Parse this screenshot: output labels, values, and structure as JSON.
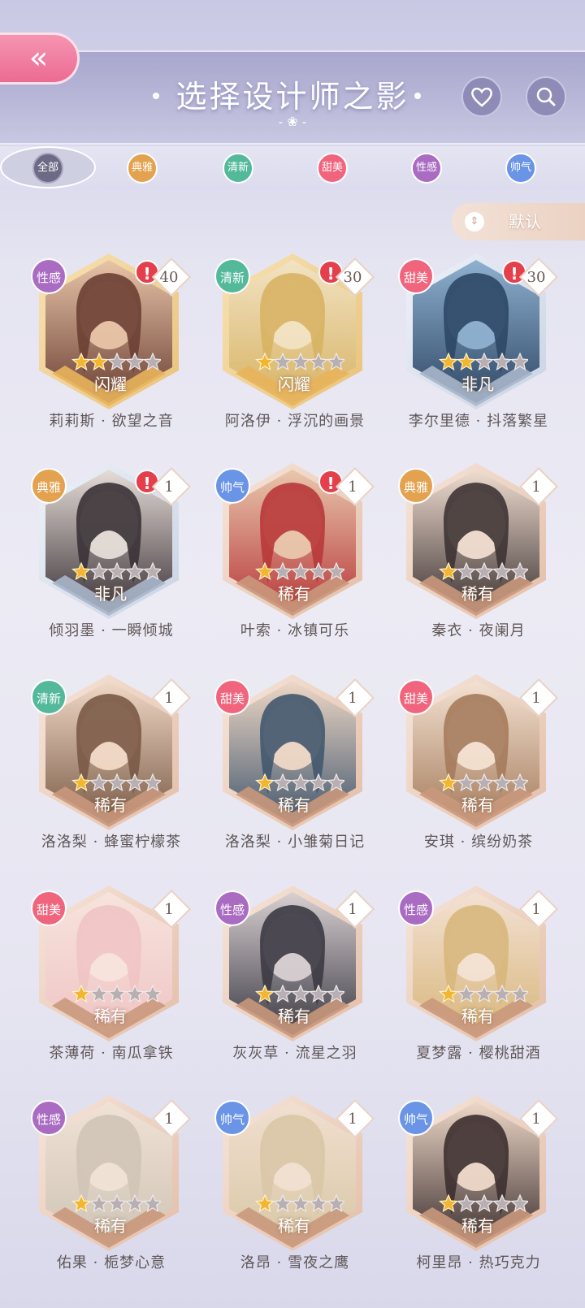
{
  "header": {
    "title": "选择设计师之影",
    "back_icon": "double-chevron-left",
    "favorite_icon": "heart",
    "search_icon": "magnifier"
  },
  "tabs": [
    {
      "label": "全部",
      "color": "#6d6a86",
      "selected": true
    },
    {
      "label": "典雅",
      "color": "#e3a24f",
      "selected": false
    },
    {
      "label": "清新",
      "color": "#53b99a",
      "selected": false
    },
    {
      "label": "甜美",
      "color": "#f0657d",
      "selected": false
    },
    {
      "label": "性感",
      "color": "#a96cc2",
      "selected": false
    },
    {
      "label": "帅气",
      "color": "#6a94e5",
      "selected": false
    }
  ],
  "sort": {
    "label": "默认",
    "icon": "sort-updown"
  },
  "cards": [
    {
      "style": "性感",
      "style_color": "#a96cc2",
      "alert": true,
      "count": "40",
      "rarity": "闪耀",
      "rarity_tone": "gold",
      "stars_filled": 2,
      "stars_total": 5,
      "name": "莉莉斯 · 欲望之音",
      "palette": [
        "#6b4034",
        "#e8c4a8"
      ]
    },
    {
      "style": "清新",
      "style_color": "#53b99a",
      "alert": true,
      "count": "30",
      "rarity": "闪耀",
      "rarity_tone": "gold",
      "stars_filled": 1,
      "stars_total": 5,
      "name": "阿洛伊 · 浮沉的画景",
      "palette": [
        "#d7b363",
        "#f2e3c4"
      ]
    },
    {
      "style": "甜美",
      "style_color": "#f0657d",
      "alert": true,
      "count": "30",
      "rarity": "非凡",
      "rarity_tone": "silver",
      "stars_filled": 2,
      "stars_total": 5,
      "name": "李尔里德 · 抖落繁星",
      "palette": [
        "#2e4866",
        "#8fb0cf"
      ]
    },
    {
      "style": "典雅",
      "style_color": "#e3a24f",
      "alert": true,
      "count": "1",
      "rarity": "非凡",
      "rarity_tone": "silver",
      "stars_filled": 1,
      "stars_total": 5,
      "name": "倾羽墨 · 一瞬倾城",
      "palette": [
        "#3a3236",
        "#e6ddd8"
      ]
    },
    {
      "style": "帅气",
      "style_color": "#6a94e5",
      "alert": true,
      "count": "1",
      "rarity": "稀有",
      "rarity_tone": "bronze",
      "stars_filled": 1,
      "stars_total": 5,
      "name": "叶索 · 冰镇可乐",
      "palette": [
        "#b8393a",
        "#e8c7ad"
      ]
    },
    {
      "style": "典雅",
      "style_color": "#e3a24f",
      "alert": false,
      "count": "1",
      "rarity": "稀有",
      "rarity_tone": "bronze",
      "stars_filled": 1,
      "stars_total": 5,
      "name": "秦衣 · 夜阑月",
      "palette": [
        "#3e3434",
        "#f0ddd0"
      ]
    },
    {
      "style": "清新",
      "style_color": "#53b99a",
      "alert": false,
      "count": "1",
      "rarity": "稀有",
      "rarity_tone": "bronze",
      "stars_filled": 1,
      "stars_total": 5,
      "name": "洛洛梨 · 蜂蜜柠檬茶",
      "palette": [
        "#7a5a46",
        "#f1dac7"
      ]
    },
    {
      "style": "甜美",
      "style_color": "#f0657d",
      "alert": false,
      "count": "1",
      "rarity": "稀有",
      "rarity_tone": "bronze",
      "stars_filled": 1,
      "stars_total": 5,
      "name": "洛洛梨 · 小雏菊日记",
      "palette": [
        "#43586e",
        "#efd8c6"
      ]
    },
    {
      "style": "甜美",
      "style_color": "#f0657d",
      "alert": false,
      "count": "1",
      "rarity": "稀有",
      "rarity_tone": "bronze",
      "stars_filled": 1,
      "stars_total": 5,
      "name": "安琪 · 缤纷奶茶",
      "palette": [
        "#a57b5c",
        "#f3e2d2"
      ]
    },
    {
      "style": "甜美",
      "style_color": "#f0657d",
      "alert": false,
      "count": "1",
      "rarity": "稀有",
      "rarity_tone": "bronze",
      "stars_filled": 1,
      "stars_total": 5,
      "name": "茶薄荷 · 南瓜拿铁",
      "palette": [
        "#efc4c4",
        "#f7e4dc"
      ]
    },
    {
      "style": "性感",
      "style_color": "#a96cc2",
      "alert": false,
      "count": "1",
      "rarity": "稀有",
      "rarity_tone": "bronze",
      "stars_filled": 1,
      "stars_total": 5,
      "name": "灰灰草 · 流星之羽",
      "palette": [
        "#3c3a44",
        "#d8d0d2"
      ]
    },
    {
      "style": "性感",
      "style_color": "#a96cc2",
      "alert": false,
      "count": "1",
      "rarity": "稀有",
      "rarity_tone": "bronze",
      "stars_filled": 1,
      "stars_total": 5,
      "name": "夏梦露 · 樱桃甜酒",
      "palette": [
        "#d8b77c",
        "#f3e1d4"
      ]
    },
    {
      "style": "性感",
      "style_color": "#a96cc2",
      "alert": false,
      "count": "1",
      "rarity": "稀有",
      "rarity_tone": "bronze",
      "stars_filled": 1,
      "stars_total": 5,
      "name": "佑果 · 栀梦心意",
      "palette": [
        "#cfc4b6",
        "#f0e2d6"
      ]
    },
    {
      "style": "帅气",
      "style_color": "#6a94e5",
      "alert": false,
      "count": "1",
      "rarity": "稀有",
      "rarity_tone": "bronze",
      "stars_filled": 1,
      "stars_total": 5,
      "name": "洛昂 · 雪夜之鹰",
      "palette": [
        "#d9c7a6",
        "#f1dfd0"
      ]
    },
    {
      "style": "帅气",
      "style_color": "#6a94e5",
      "alert": false,
      "count": "1",
      "rarity": "稀有",
      "rarity_tone": "bronze",
      "stars_filled": 1,
      "stars_total": 5,
      "name": "柯里昂 · 热巧克力",
      "palette": [
        "#3d3030",
        "#eed8c8"
      ]
    }
  ]
}
